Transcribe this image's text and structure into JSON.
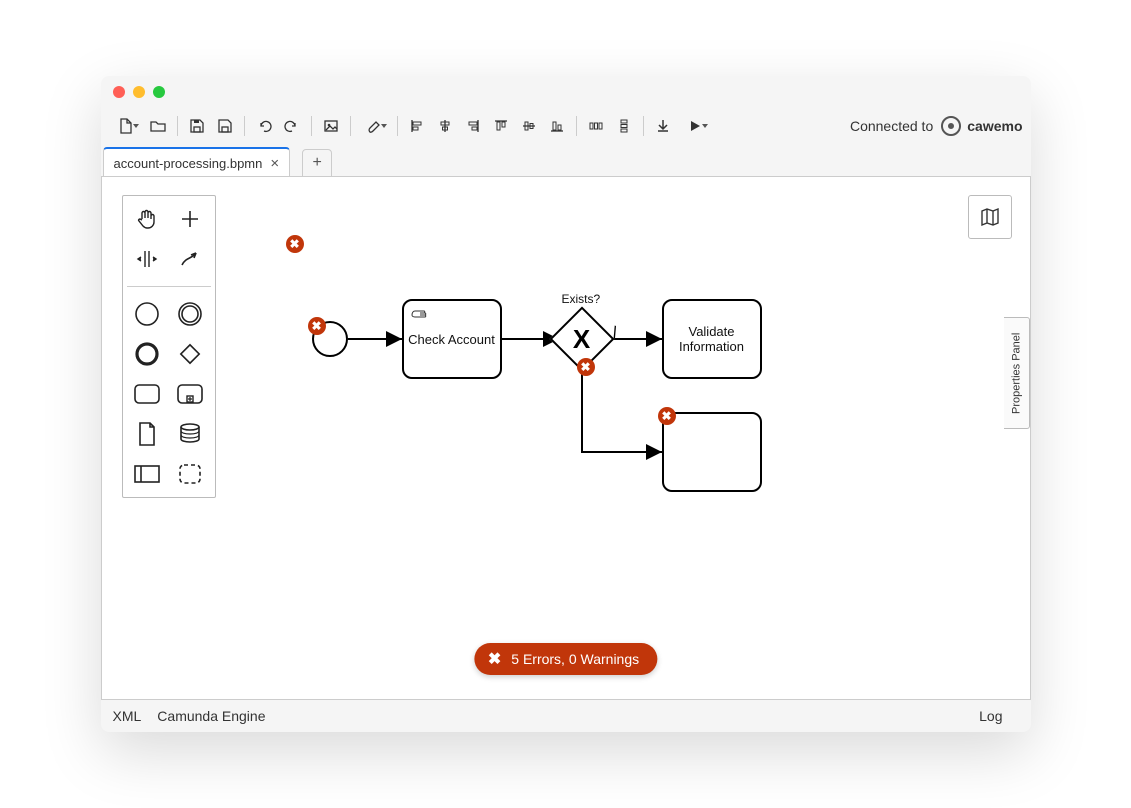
{
  "connect_label": "Connected to",
  "connect_brand": "cawemo",
  "tab": {
    "name": "account-processing.bpmn"
  },
  "tab_close": "×",
  "tab_add": "+",
  "properties_panel_label": "Properties Panel",
  "errors_text": "5 Errors, 0 Warnings",
  "gateway_label": "Exists?",
  "gateway_mark": "X",
  "task1_label": "Check Account",
  "task2_label": "Validate Information",
  "error_badge_glyph": "✖",
  "statusbar": {
    "xml": "XML",
    "engine": "Camunda Engine",
    "log": "Log"
  },
  "toolbar_icons": [
    "new-file",
    "open",
    "save",
    "save-as",
    "undo",
    "redo",
    "image",
    "color-picker",
    "align-left",
    "align-center",
    "align-right",
    "dist-h",
    "dist-c",
    "dist-v",
    "dist-group",
    "dist-edge",
    "download",
    "play"
  ],
  "palette_items": [
    "hand-tool",
    "lasso-tool",
    "space-tool",
    "connect-tool",
    "start-event",
    "intermediate-event",
    "end-event",
    "gateway",
    "task",
    "subprocess",
    "data-object",
    "data-store",
    "participant",
    "group"
  ]
}
